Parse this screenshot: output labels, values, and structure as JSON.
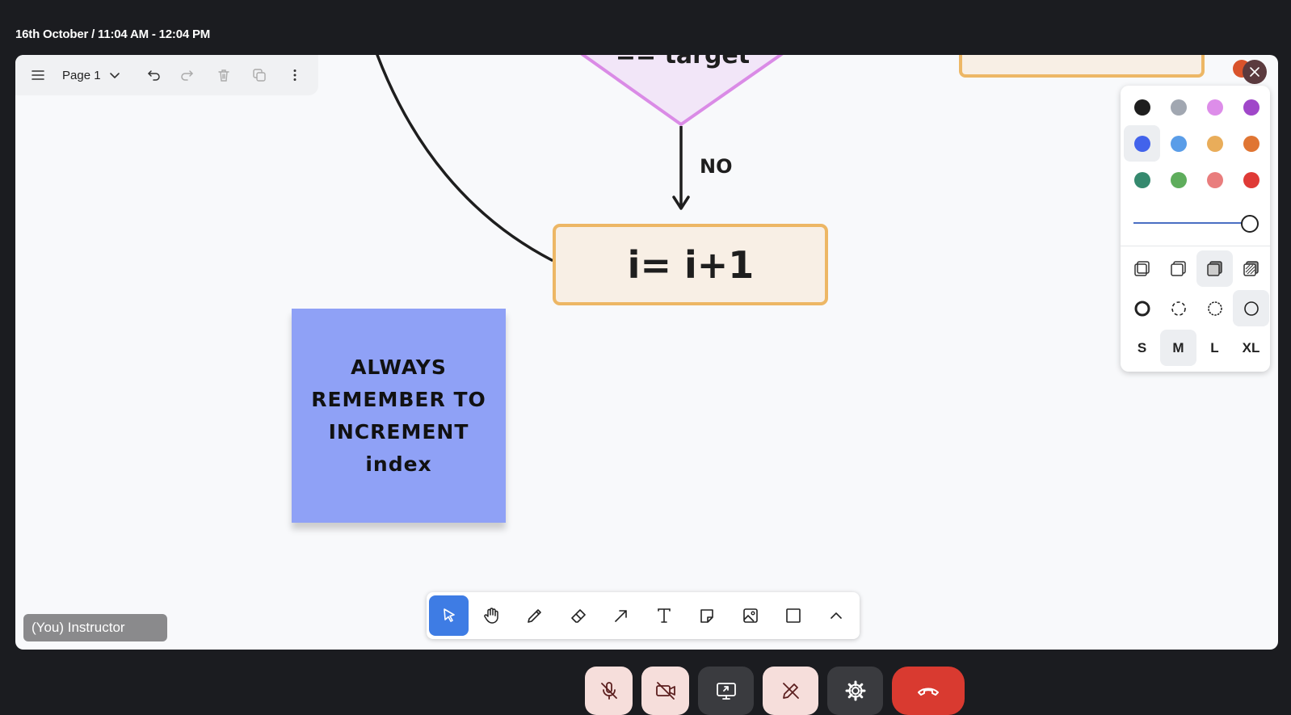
{
  "session": {
    "time_label": "16th October / 11:04 AM - 12:04 PM"
  },
  "toolbar_top": {
    "page_label": "Page 1",
    "icons": [
      "menu-icon",
      "chevron-down-icon",
      "undo-icon",
      "redo-icon",
      "trash-icon",
      "duplicate-icon",
      "more-vertical-icon"
    ]
  },
  "canvas": {
    "diamond_text": "== target",
    "edge_label": "NO",
    "box_text": "i= i+1",
    "sticky_text": "ALWAYS REMEMBER TO INCREMENT index",
    "colors": {
      "diamond_fill": "#f2e6f8",
      "diamond_stroke": "#da8be6",
      "box_fill": "#f8efe5",
      "box_stroke": "#edb765",
      "sticky_fill": "#8fa1f6",
      "line": "#1e1e1e"
    }
  },
  "style_panel": {
    "colors": [
      {
        "name": "black",
        "hex": "#1e1e1e"
      },
      {
        "name": "grey",
        "hex": "#a1a7b1"
      },
      {
        "name": "light-violet",
        "hex": "#dd8de9"
      },
      {
        "name": "violet",
        "hex": "#a047c9"
      },
      {
        "name": "blue",
        "hex": "#4263eb"
      },
      {
        "name": "light-blue",
        "hex": "#5a9de8"
      },
      {
        "name": "yellow",
        "hex": "#e9ad5a"
      },
      {
        "name": "orange",
        "hex": "#e07533"
      },
      {
        "name": "green",
        "hex": "#35896e"
      },
      {
        "name": "light-green",
        "hex": "#5ead5c"
      },
      {
        "name": "light-red",
        "hex": "#e97d7d"
      },
      {
        "name": "red",
        "hex": "#df3a36"
      }
    ],
    "selected_color": "blue",
    "opacity": 1.0,
    "fill_styles": [
      "fill-none-icon",
      "fill-semi-icon",
      "fill-solid-icon",
      "fill-pattern-icon"
    ],
    "selected_fill": "fill-solid-icon",
    "dash_styles": [
      "dash-draw-icon",
      "dash-dashed-icon",
      "dash-dotted-icon",
      "dash-solid-icon"
    ],
    "selected_dash": "dash-solid-icon",
    "sizes": [
      "S",
      "M",
      "L",
      "XL"
    ],
    "selected_size": "M"
  },
  "tools": [
    "select-icon",
    "hand-icon",
    "pencil-icon",
    "eraser-icon",
    "arrow-icon",
    "text-icon",
    "note-icon",
    "image-icon",
    "rectangle-icon",
    "chevron-up-icon"
  ],
  "active_tool": "select-icon",
  "participant": {
    "label": "(You) Instructor"
  },
  "call_controls": [
    "mic-off-icon",
    "camera-off-icon",
    "screen-share-icon",
    "whiteboard-icon",
    "settings-icon",
    "hang-up-icon"
  ],
  "accent": "#3e7ce4"
}
